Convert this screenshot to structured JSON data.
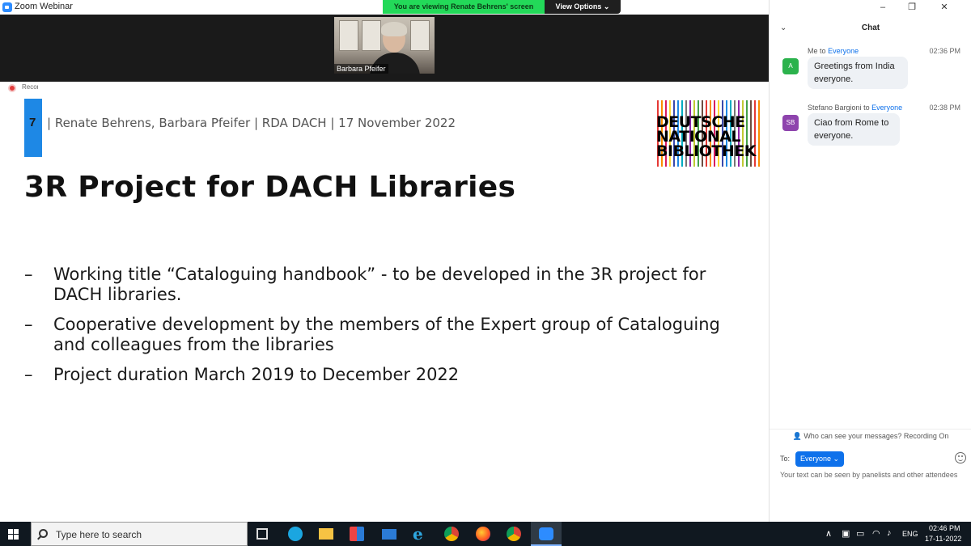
{
  "window": {
    "app_title": "Zoom Webinar",
    "share_banner": "You are viewing Renate Behrens' screen",
    "view_options": "View Options"
  },
  "video": {
    "participant_name": "Barbara Pfeifer"
  },
  "recording": {
    "label": "Recording"
  },
  "slide": {
    "number": "7",
    "header": "| Renate Behrens, Barbara Pfeifer | RDA DACH | 17 November 2022",
    "title": "3R Project for DACH Libraries",
    "logo": [
      "DEUTSCHE",
      "NATIONAL",
      "BIBLIOTHEK"
    ],
    "bullets": [
      {
        "dash": "–",
        "text": "Working title “Cataloguing handbook” - to be developed in the 3R project for DACH libraries."
      },
      {
        "dash": "–",
        "text": "Cooperative development by the members of the Expert group of Cataloguing and colleagues from the libraries"
      },
      {
        "dash": "–",
        "text": "Project duration March 2019 to December 2022"
      }
    ]
  },
  "chat": {
    "title": "Chat",
    "messages": [
      {
        "sender": "Me",
        "to_word": "to",
        "recipient": "Everyone",
        "time": "02:36 PM",
        "avatar_initials": "A",
        "avatar_color": "#2bb24c",
        "text": "Greetings from India everyone."
      },
      {
        "sender": "Stefano Bargioni",
        "to_word": "to",
        "recipient": "Everyone",
        "time": "02:38 PM",
        "avatar_initials": "SB",
        "avatar_color": "#8e44ad",
        "text": "Ciao from Rome to everyone."
      }
    ],
    "notice": "Who can see your messages? Recording On",
    "to_label": "To:",
    "to_value": "Everyone",
    "input_placeholder": "Your text can be seen by panelists and other attendees"
  },
  "taskbar": {
    "search_placeholder": "Type here to search",
    "language": "ENG",
    "time": "02:46 PM",
    "date": "17-11-2022"
  },
  "colors": {
    "zoom_blue": "#0e71eb",
    "share_green": "#23d959",
    "slide_accent": "#1e88e5",
    "taskbar": "#101820"
  }
}
